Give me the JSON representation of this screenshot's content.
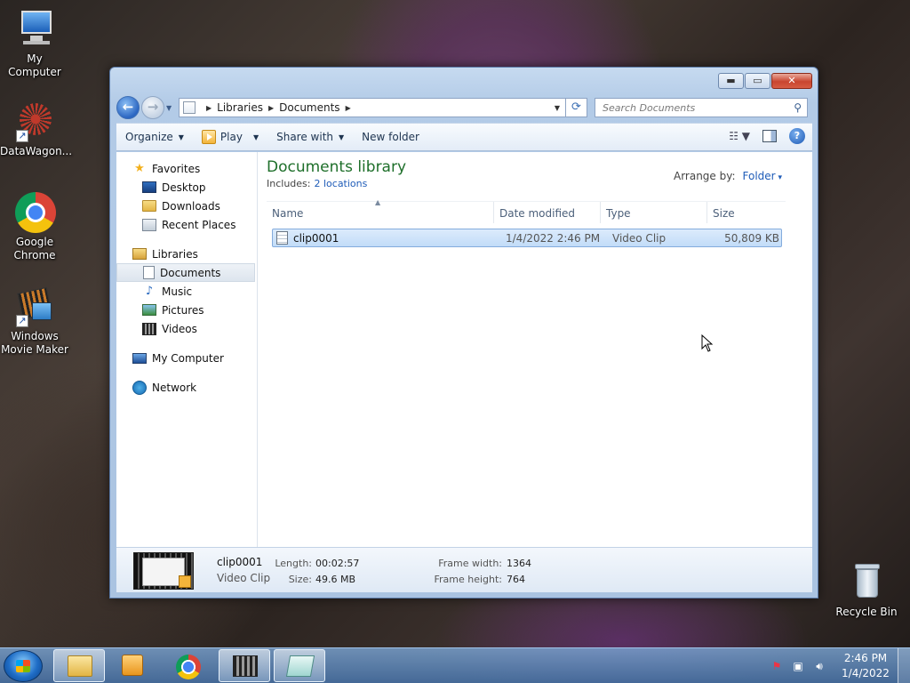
{
  "desktop": {
    "icons": [
      {
        "label": "My Computer"
      },
      {
        "label": "DataWagon..."
      },
      {
        "label": "Google Chrome"
      },
      {
        "label": "Windows Movie Maker"
      },
      {
        "label": "Recycle Bin"
      }
    ]
  },
  "window": {
    "caption": {
      "minimize": "▬",
      "maximize": "▭",
      "close": "✕"
    },
    "nav": {
      "back": "←",
      "forward": "→",
      "breadcrumb": [
        "Libraries",
        "Documents"
      ],
      "refresh": "⟳",
      "search_placeholder": "Search Documents"
    },
    "toolbar": {
      "organize": "Organize",
      "play": "Play",
      "share_with": "Share with",
      "new_folder": "New folder",
      "help": "?"
    },
    "navpane": {
      "favorites": "Favorites",
      "desktop": "Desktop",
      "downloads": "Downloads",
      "recent_places": "Recent Places",
      "libraries": "Libraries",
      "documents": "Documents",
      "music": "Music",
      "pictures": "Pictures",
      "videos": "Videos",
      "my_computer": "My Computer",
      "network": "Network"
    },
    "library": {
      "title": "Documents library",
      "includes_label": "Includes:",
      "includes_link": "2 locations",
      "arrange_label": "Arrange by:",
      "arrange_value": "Folder"
    },
    "columns": {
      "name": "Name",
      "date": "Date modified",
      "type": "Type",
      "size": "Size"
    },
    "files": [
      {
        "name": "clip0001",
        "date": "1/4/2022 2:46 PM",
        "type": "Video Clip",
        "size": "50,809 KB"
      }
    ],
    "details": {
      "name": "clip0001",
      "kind": "Video Clip",
      "length_label": "Length:",
      "length": "00:02:57",
      "size_label": "Size:",
      "size": "49.6 MB",
      "frame_width_label": "Frame width:",
      "frame_width": "1364",
      "frame_height_label": "Frame height:",
      "frame_height": "764"
    }
  },
  "taskbar": {
    "clock_time": "2:46 PM",
    "clock_date": "1/4/2022"
  },
  "colors": {
    "library_title": "#1e6f2a",
    "link": "#1f5cb8",
    "selection": "#c2dcf8"
  }
}
